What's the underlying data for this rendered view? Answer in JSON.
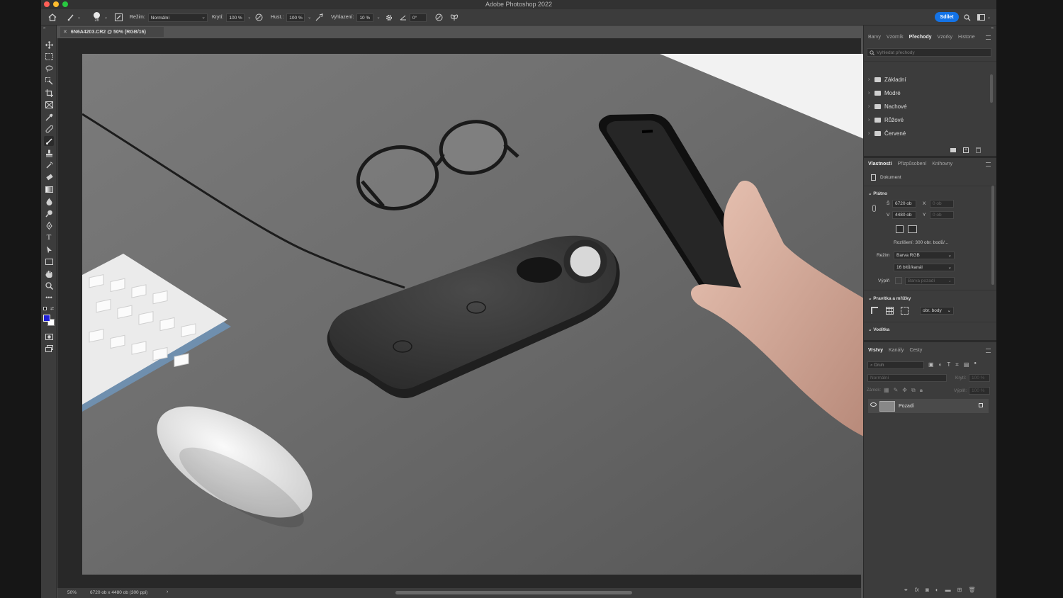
{
  "window": {
    "title": "Adobe Photoshop 2022"
  },
  "options": {
    "brush_size": "28",
    "mode_label": "Režim:",
    "mode_value": "Normální",
    "opacity_label": "Krytí:",
    "opacity_value": "100 %",
    "flow_label": "Hust.:",
    "flow_value": "100 %",
    "smoothing_label": "Vyhlazení:",
    "smoothing_value": "10 %",
    "angle_value": "0°",
    "share_label": "Sdílet"
  },
  "document": {
    "tab_label": "6N6A4203.CR2 @ 50% (RGB/16)"
  },
  "status": {
    "zoom": "50%",
    "info": "6720 ob x 4480 ob (300 ppi)"
  },
  "panels": {
    "top_tabs": [
      "Barvy",
      "Vzorník",
      "Přechody",
      "Vzorky",
      "Historie"
    ],
    "top_active": "Přechody",
    "gradient_search_placeholder": "Vyhledat přechody",
    "gradient_folders": [
      "Základní",
      "Modré",
      "Nachové",
      "Růžové",
      "Červené"
    ],
    "mid_tabs": [
      "Vlastnosti",
      "Přizpůsobení",
      "Knihovny"
    ],
    "doc_label": "Dokument",
    "canvas": {
      "title": "Plátno",
      "w_label": "Š",
      "w_value": "6720 ob",
      "h_label": "V",
      "h_value": "4480 ob",
      "x_label": "X",
      "x_value": "0 ob",
      "y_label": "Y",
      "y_value": "0 ob",
      "resolution": "Rozlišení: 300 obr. bodů/...",
      "mode_label": "Režim",
      "mode_value": "Barva RGB",
      "depth_value": "16 bitů/kanál",
      "fill_label": "Výplň",
      "fill_value": "Barva pozadí"
    },
    "rulers_title": "Pravítka a mřížky",
    "rulers_unit": "obr. body",
    "guides_title": "Vodítka",
    "layers_tabs": [
      "Vrstvy",
      "Kanály",
      "Cesty"
    ],
    "layers_search": "Druh",
    "blend_mode": "Normální",
    "opacity_label": "Krytí:",
    "opacity_value": "100 %",
    "lock_label": "Zámek:",
    "fill_label": "Výplň:",
    "fill_value": "100 %",
    "layer_name": "Pozadí"
  }
}
